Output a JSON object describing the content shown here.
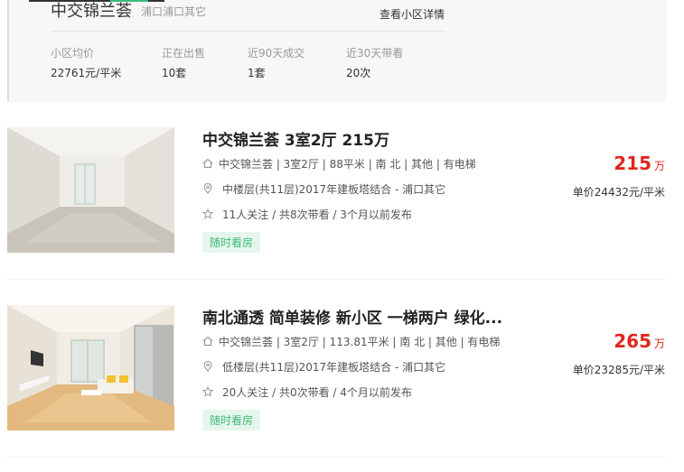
{
  "community": {
    "name": "中交锦兰荟",
    "area": "浦口浦口其它",
    "detail_link": "查看小区详情",
    "stats": [
      {
        "label": "小区均价",
        "value": "22761元/平米"
      },
      {
        "label": "正在出售",
        "value": "10套"
      },
      {
        "label": "近90天成交",
        "value": "1套"
      },
      {
        "label": "近30天带看",
        "value": "20次"
      }
    ]
  },
  "listings": [
    {
      "title": "中交锦兰荟 3室2厅 215万",
      "house_info": "中交锦兰荟 | 3室2厅 | 88平米 | 南 北 | 其他 | 有电梯",
      "position_info": "中楼层(共11层)2017年建板塔结合 - 浦口其它",
      "follow_info": "11人关注 / 共8次带看 / 3个月以前发布",
      "tag": "随时看房",
      "price": "215",
      "price_unit": "万",
      "unit_price": "单价24432元/平米"
    },
    {
      "title": "南北通透 简单装修 新小区 一梯两户 绿化...",
      "house_info": "中交锦兰荟 | 3室2厅 | 113.81平米 | 南 北 | 其他 | 有电梯",
      "position_info": "低楼层(共11层)2017年建板塔结合 - 浦口其它",
      "follow_info": "20人关注 / 共0次带看 / 4个月以前发布",
      "tag": "随时看房",
      "price": "265",
      "price_unit": "万",
      "unit_price": "单价23285元/平米"
    }
  ],
  "colors": {
    "accent_green": "#3dbb76",
    "price_red": "#e1251b"
  }
}
